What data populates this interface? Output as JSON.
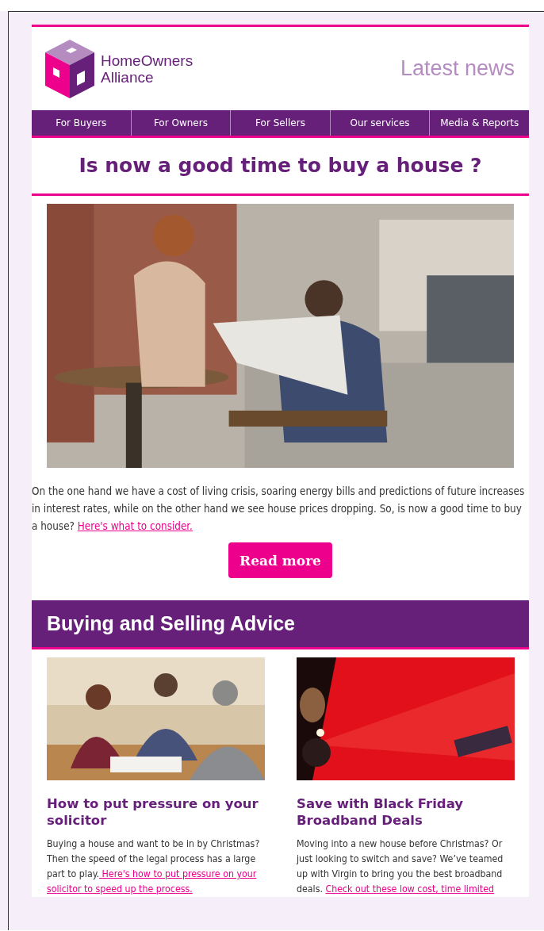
{
  "header": {
    "brand_line_1": "HomeOwners",
    "brand_line_2": "Alliance",
    "tagline": "Latest news"
  },
  "nav": [
    {
      "label": "For Buyers"
    },
    {
      "label": "For Owners"
    },
    {
      "label": "For Sellers"
    },
    {
      "label": "Our services"
    },
    {
      "label": "Media & Reports"
    }
  ],
  "feature": {
    "title": "Is now a good time to buy a house ?",
    "image": {
      "kind": "picture"
    },
    "body": "On the one hand we have a cost of living crisis, soaring energy bills and predictions of future increases in interest rates, while on the other hand we see house prices dropping. So, is now a good time to buy a house?",
    "link": "Here's what to consider.",
    "button": "Read more"
  },
  "section": {
    "title": "Buying and Selling Advice"
  },
  "articles": [
    {
      "image": {
        "kind": "picture"
      },
      "title": "How to put pressure on your solicitor",
      "body": "Buying a house and want to be in by Christmas? Then the speed of the legal process has a large part to play.",
      "link": [
        " Here's how to put pressure on your",
        "solicitor to speed up the process."
      ]
    },
    {
      "image": {
        "kind": "picture"
      },
      "title": "Save with Black Friday Broadband Deals",
      "body": "Moving into a new house before Christmas? Or just looking to switch and save? We’ve teamed up with Virgin to bring you the best broadband deals.",
      "link": [
        "Check out these low cost, time limited"
      ]
    }
  ]
}
